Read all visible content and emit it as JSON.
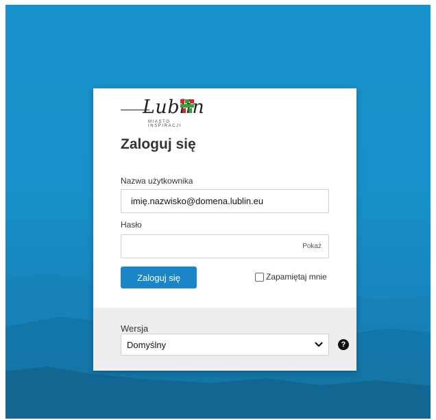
{
  "logo": {
    "name": "Lublin",
    "tagline": "MIASTO INSPIRACJI"
  },
  "login": {
    "title": "Zaloguj się",
    "username_label": "Nazwa użytkownika",
    "username_value": "imię.nazwisko@domena.lublin.eu",
    "password_label": "Hasło",
    "password_value": "",
    "show_password": "Pokaż",
    "submit_label": "Zaloguj się",
    "remember_label": "Zapamiętaj mnie",
    "remember_checked": false
  },
  "version": {
    "label": "Wersja",
    "selected": "Domyślny",
    "help_icon": "?"
  },
  "colors": {
    "background": "#1890c9",
    "accent": "#1a86c8",
    "footer": "#eeeeee"
  },
  "icons": {
    "help": "question-circle-icon",
    "dropdown": "chevron-down-icon",
    "crest": "lublin-crest-icon"
  }
}
